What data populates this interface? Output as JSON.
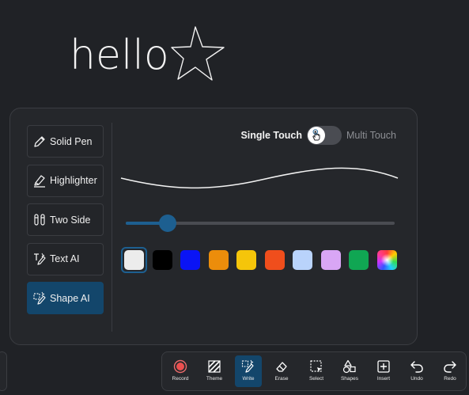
{
  "canvas": {
    "text": "hello"
  },
  "pen_panel": {
    "tools": [
      {
        "label": "Solid Pen",
        "icon": "pen-icon",
        "active": false
      },
      {
        "label": "Highlighter",
        "icon": "highlighter-icon",
        "active": false
      },
      {
        "label": "Two Side",
        "icon": "two-side-pen-icon",
        "active": false
      },
      {
        "label": "Text AI",
        "icon": "text-ai-icon",
        "active": false
      },
      {
        "label": "Shape AI",
        "icon": "shape-ai-icon",
        "active": true
      }
    ],
    "touch": {
      "single_label": "Single Touch",
      "multi_label": "Multi Touch",
      "mode": "single"
    },
    "thickness_fraction": 0.155,
    "colors": [
      "#ececec",
      "#000000",
      "#0a14f5",
      "#ec8d0b",
      "#f5c50a",
      "#f04e1c",
      "#b9d3fb",
      "#d9a6f5",
      "#10a653",
      "rainbow"
    ],
    "selected_color_index": 0
  },
  "toolbar": {
    "items": [
      {
        "label": "Record",
        "icon": "record-icon"
      },
      {
        "label": "Theme",
        "icon": "theme-icon"
      },
      {
        "label": "Write",
        "icon": "write-icon",
        "active": true
      },
      {
        "label": "Erase",
        "icon": "eraser-icon"
      },
      {
        "label": "Select",
        "icon": "select-icon"
      },
      {
        "label": "Shapes",
        "icon": "shapes-icon"
      },
      {
        "label": "Insert",
        "icon": "insert-icon"
      },
      {
        "label": "Undo",
        "icon": "undo-icon"
      },
      {
        "label": "Redo",
        "icon": "redo-icon"
      }
    ]
  }
}
